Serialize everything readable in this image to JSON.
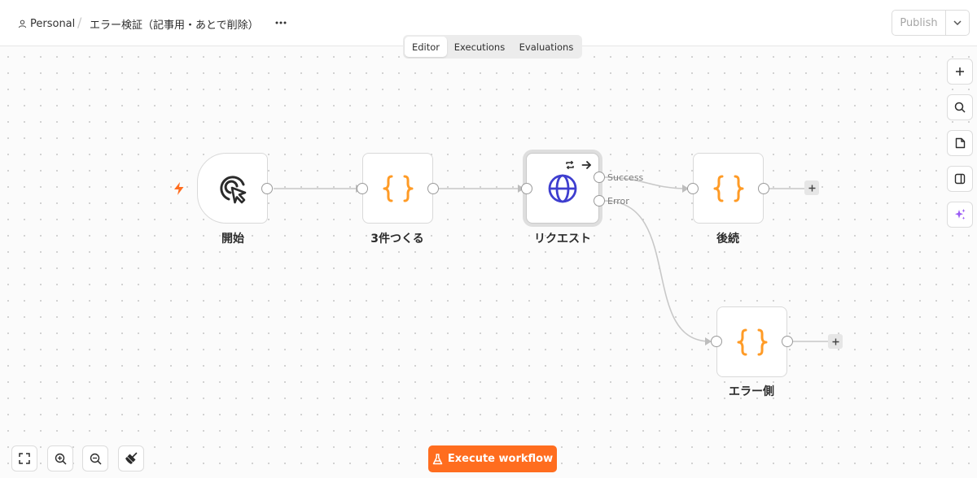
{
  "header": {
    "project": "Personal",
    "separator": "/",
    "workflow_name": "エラー検証（記事用・あとで削除）",
    "publish_label": "Publish"
  },
  "tabs": [
    {
      "label": "Editor",
      "active": true
    },
    {
      "label": "Executions",
      "active": false
    },
    {
      "label": "Evaluations",
      "active": false
    }
  ],
  "nodes": {
    "start": {
      "label": "開始",
      "icon": "cursor-click-icon"
    },
    "make3": {
      "label": "3件つくる",
      "icon": "code-braces-icon"
    },
    "request": {
      "label": "リクエスト",
      "icon": "globe-icon"
    },
    "followup": {
      "label": "後続",
      "icon": "code-braces-icon"
    },
    "error_side": {
      "label": "エラー側",
      "icon": "code-braces-icon"
    }
  },
  "outputs": {
    "success": "Success",
    "error": "Error"
  },
  "execute_label": "Execute workflow",
  "colors": {
    "accent": "#ff6d1f",
    "code_icon": "#ff9b26",
    "globe_icon": "#3e3ecf",
    "ai_icon": "#9b5cf5",
    "edge": "#c8c8c8"
  }
}
